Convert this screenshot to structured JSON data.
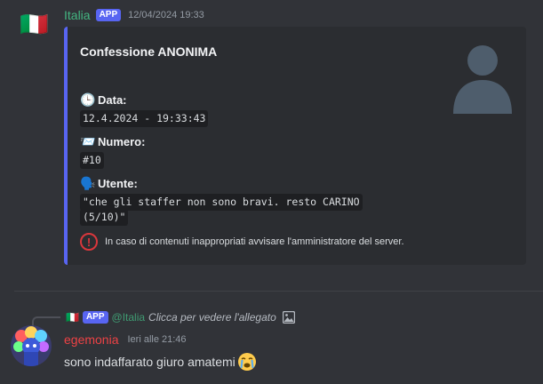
{
  "message1": {
    "avatar_flag": "🇮🇹",
    "username": "Italia",
    "badge": "APP",
    "timestamp": "12/04/2024 19:33",
    "embed": {
      "accent_color": "#5865f2",
      "title": "Confessione ANONIMA",
      "thumbnail_icon": "default-user-avatar-icon",
      "fields": [
        {
          "emoji": "🕒",
          "name": "Data:",
          "value": "12.4.2024 - 19:33:43"
        },
        {
          "emoji": "📨",
          "name": "Numero:",
          "value": "#10"
        },
        {
          "emoji": "🗣️",
          "name": "Utente:",
          "value_line1": "\"che gli staffer non sono bravi. resto CARINO",
          "value_line2": "(5/10)\""
        }
      ],
      "footer_icon": "exclamation-icon",
      "footer_text": "In caso di contenuti inappropriati avvisare l'amministratore del server."
    }
  },
  "message2": {
    "reply": {
      "flag": "🇮🇹",
      "badge": "APP",
      "mention": "@Italia",
      "text": "Clicca per vedere l'allegato",
      "icon": "image-icon"
    },
    "username": "egemonia",
    "timestamp": "Ieri alle 21:46",
    "content": "sono indaffarato giuro amatemi",
    "emoji_icon": "sob-emoji-icon",
    "username_color": "#ed4245"
  }
}
